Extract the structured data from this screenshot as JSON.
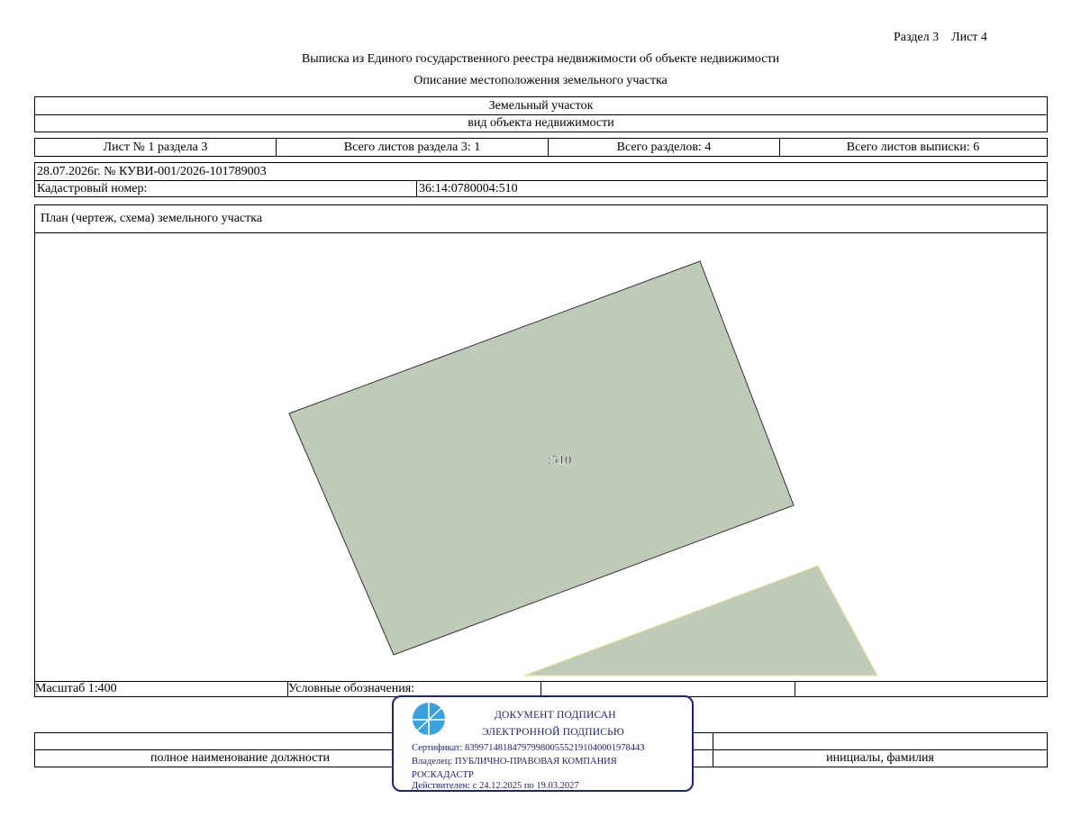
{
  "header": {
    "section": "Раздел 3",
    "sheet": "Лист 4",
    "title": "Выписка из Единого государственного реестра недвижимости об объекте недвижимости",
    "subtitle": "Описание местоположения земельного участка"
  },
  "object": {
    "type": "Земельный участок",
    "type_caption": "вид объекта недвижимости"
  },
  "sheets": {
    "sheet_of_section": "Лист № 1 раздела 3",
    "total_sheets_section": "Всего листов раздела 3: 1",
    "total_sections": "Всего разделов: 4",
    "total_sheets_extract": "Всего листов выписки: 6"
  },
  "record": {
    "date_number": "28.07.2026г. № КУВИ-001/2026-101789003",
    "cadastral_label": "Кадастровый номер:",
    "cadastral_value": "36:14:0780004:510"
  },
  "plan": {
    "title": "План (чертеж, схема) земельного участка",
    "parcel_label": ":510",
    "colors": {
      "parcel_fill": "#bfcbb8",
      "parcel_stroke": "#333333",
      "neighbor_stroke": "#e2e89a"
    }
  },
  "legend": {
    "scale": "Масштаб 1:400",
    "legend_label": "Условные обозначения:"
  },
  "signature": {
    "position_caption": "полное наименование должности",
    "name_caption": "инициалы, фамилия"
  },
  "stamp": {
    "line1": "ДОКУМЕНТ ПОДПИСАН",
    "line2": "ЭЛЕКТРОННОЙ ПОДПИСЬЮ",
    "certificate": "Сертификат: 8399714818479799800555219104000197844З",
    "owner_line1": "Владелец: ПУБЛИЧНО-ПРАВОВАЯ КОМПАНИЯ",
    "owner_line2": "РОСКАДАСТР",
    "validity": "Действителен: с 24.12.2025 по 19.03.2027",
    "colors": {
      "ink": "#1a237e",
      "logo": "#3aa0e0"
    }
  }
}
